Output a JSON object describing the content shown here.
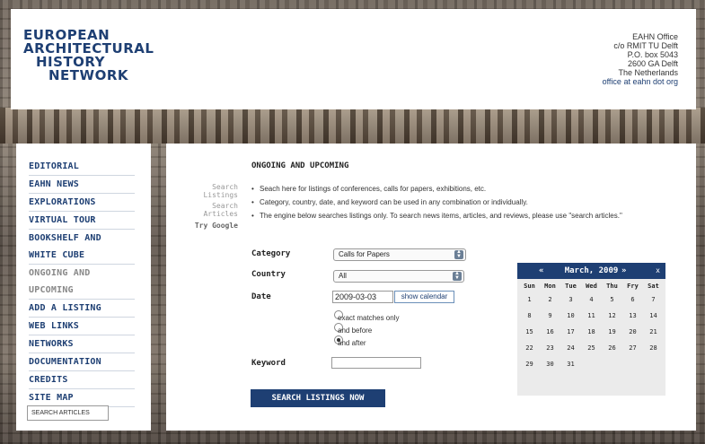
{
  "header": {
    "logo_lines": [
      "EUROPEAN",
      "ARCHITECTURAL",
      "HISTORY",
      "NETWORK"
    ],
    "address_lines": [
      "EAHN Office",
      "c/o RMIT TU Delft",
      "P.O. box 5043",
      "2600 GA Delft",
      "The Netherlands"
    ],
    "email": "office at eahn dot org"
  },
  "nav": {
    "items": [
      "EDITORIAL",
      "EAHN NEWS",
      "EXPLORATIONS",
      "VIRTUAL TOUR",
      "BOOKSHELF AND WHITE CUBE",
      "ONGOING AND UPCOMING",
      "ADD A LISTING",
      "WEB LINKS",
      "NETWORKS",
      "DOCUMENTATION",
      "CREDITS",
      "SITE MAP"
    ],
    "search_articles_value": "SEARCH ARTICLES"
  },
  "main": {
    "side_links": [
      "Search Listings",
      "Search Articles",
      "Try Google"
    ],
    "title": "ONGOING AND UPCOMING",
    "bullets": [
      "Seach here for listings of conferences, calls for papers, exhibitions, etc.",
      "Category, country, date, and keyword can be used in any combination or individually.",
      "The engine below searches listings only.  To search news items, articles, and reviews, please use \"search articles.\""
    ]
  },
  "form": {
    "category_label": "Category",
    "category_value": "Calls for Papers",
    "country_label": "Country",
    "country_value": "All",
    "date_label": "Date",
    "date_value": "2009-03-03",
    "show_calendar": "show calendar",
    "radio_options": [
      "exact matches only",
      "and before",
      "and after"
    ],
    "radio_selected": "and after",
    "keyword_label": "Keyword",
    "keyword_value": "",
    "submit_label": "SEARCH LISTINGS NOW"
  },
  "calendar": {
    "prev": "«",
    "title": "March, 2009",
    "next": "»",
    "close": "x",
    "weekdays": [
      "Sun",
      "Mon",
      "Tue",
      "Wed",
      "Thu",
      "Fry",
      "Sat"
    ],
    "weeks": [
      [
        "1",
        "2",
        "3",
        "4",
        "5",
        "6",
        "7"
      ],
      [
        "8",
        "9",
        "10",
        "11",
        "12",
        "13",
        "14"
      ],
      [
        "15",
        "16",
        "17",
        "18",
        "19",
        "20",
        "21"
      ],
      [
        "22",
        "23",
        "24",
        "25",
        "26",
        "27",
        "28"
      ],
      [
        "29",
        "30",
        "31",
        "",
        "",
        "",
        ""
      ]
    ]
  },
  "colors": {
    "brand": "#1e3f73"
  }
}
